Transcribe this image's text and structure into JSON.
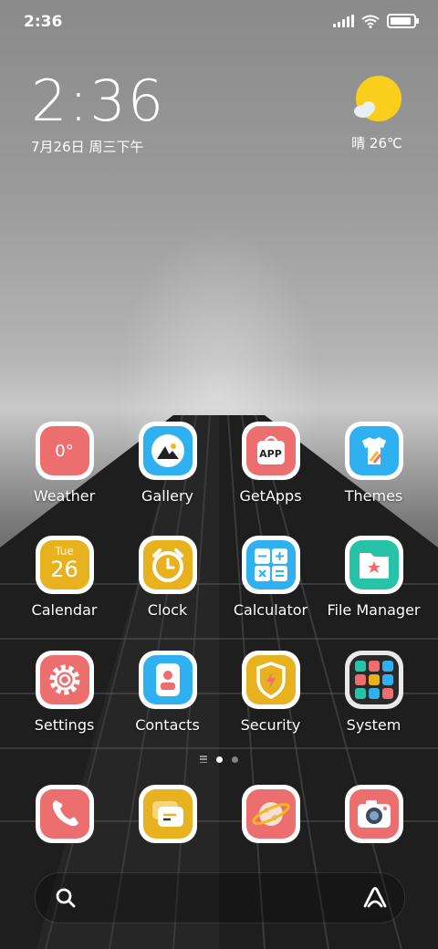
{
  "status_bar": {
    "time": "2:36",
    "battery_level": 0.9
  },
  "clock_widget": {
    "time": "2:36",
    "date": "7月26日 周三下午"
  },
  "weather_widget": {
    "text": "晴 26℃",
    "sun_color": "#f9cf1b"
  },
  "calendar_icon": {
    "day_name": "Tue",
    "day_number": "26"
  },
  "weather_icon": {
    "temp": "0°"
  },
  "apps": [
    {
      "label": "Weather",
      "icon": "weather-icon",
      "color": "#ec6e6e"
    },
    {
      "label": "Gallery",
      "icon": "gallery-icon",
      "color": "#2fb0f0"
    },
    {
      "label": "GetApps",
      "icon": "getapps-icon",
      "color": "#ec6e6e"
    },
    {
      "label": "Themes",
      "icon": "themes-icon",
      "color": "#2fb0f0"
    },
    {
      "label": "Calendar",
      "icon": "calendar-icon",
      "color": "#e7b21e"
    },
    {
      "label": "Clock",
      "icon": "clock-icon",
      "color": "#e7b21e"
    },
    {
      "label": "Calculator",
      "icon": "calculator-icon",
      "color": "#2fb0f0"
    },
    {
      "label": "File Manager",
      "icon": "file-manager-icon",
      "color": "#27c3a7"
    },
    {
      "label": "Settings",
      "icon": "settings-icon",
      "color": "#ec6e6e"
    },
    {
      "label": "Contacts",
      "icon": "contacts-icon",
      "color": "#2fb0f0"
    },
    {
      "label": "Security",
      "icon": "security-icon",
      "color": "#e7b21e"
    },
    {
      "label": "System",
      "icon": "system-folder-icon",
      "color": "#2a2a2a"
    }
  ],
  "getapps_badge": "APP",
  "dock": [
    {
      "name": "phone",
      "icon": "phone-icon",
      "color": "#ec6e6e"
    },
    {
      "name": "messages",
      "icon": "messages-icon",
      "color": "#e7b21e"
    },
    {
      "name": "browser",
      "icon": "browser-planet-icon",
      "color": "#ec6e6e"
    },
    {
      "name": "camera",
      "icon": "camera-icon",
      "color": "#ec6e6e"
    }
  ],
  "page_indicator": {
    "current_page": 1,
    "total_pages": 2
  },
  "search_bar": {
    "left_icon": "search-icon",
    "right_icon": "assistant-icon"
  }
}
